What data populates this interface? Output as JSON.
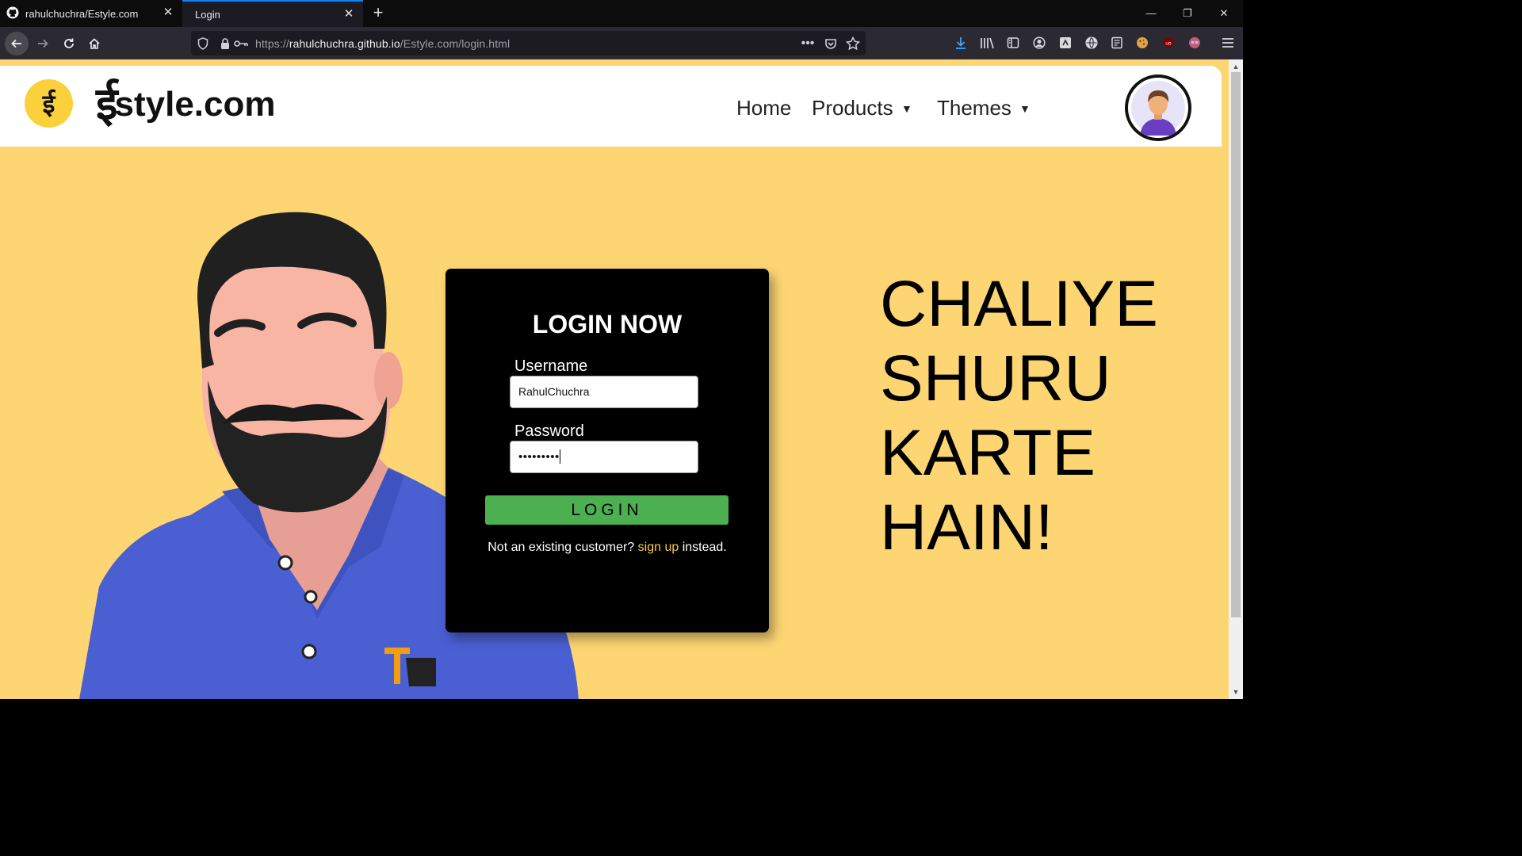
{
  "browser": {
    "tabs": [
      {
        "title": "rahulchuchra/Estyle.com",
        "active": false
      },
      {
        "title": "Login",
        "active": true
      }
    ],
    "url_prefix": "https://",
    "url_host": "rahulchuchra.github.io",
    "url_path": "/Estyle.com/login.html"
  },
  "header": {
    "logo_glyph": "ई",
    "brand_prefix": "ई",
    "brand_suffix": "style.com",
    "nav": [
      {
        "label": "Home",
        "has_dropdown": false
      },
      {
        "label": "Products",
        "has_dropdown": true
      },
      {
        "label": "Themes",
        "has_dropdown": true
      }
    ],
    "caret": "▼"
  },
  "login": {
    "title": "LOGIN NOW",
    "username_label": "Username",
    "username_value": "RahulChuchra",
    "password_label": "Password",
    "password_mask": "•••••••••",
    "button_label": "LOGIN",
    "note_before": "Not an existing customer?",
    "note_link": "sign up",
    "note_after": "instead."
  },
  "slogan": [
    "CHALIYE",
    "SHURU",
    "KARTE",
    "HAIN!"
  ],
  "colors": {
    "page_bg": "#fdd673",
    "logo_bg": "#fbd13b",
    "login_button": "#4caf50",
    "signup_link": "#fdc94a",
    "shirt": "#4a5fd1"
  }
}
